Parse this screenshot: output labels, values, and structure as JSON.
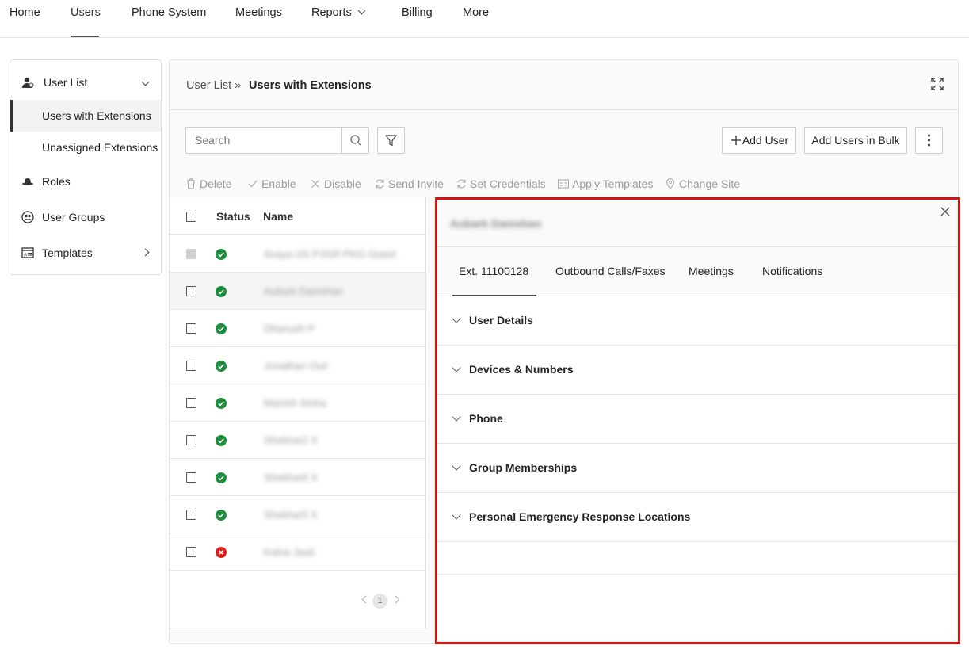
{
  "topnav": {
    "items": [
      {
        "label": "Home"
      },
      {
        "label": "Users"
      },
      {
        "label": "Phone System"
      },
      {
        "label": "Meetings"
      },
      {
        "label": "Reports"
      },
      {
        "label": "Billing"
      },
      {
        "label": "More"
      }
    ],
    "active": "Users"
  },
  "sidebar": {
    "user_list": "User List",
    "users_with_extensions": "Users with Extensions",
    "unassigned_extensions": "Unassigned Extensions",
    "roles": "Roles",
    "user_groups": "User Groups",
    "templates": "Templates"
  },
  "breadcrumb": {
    "parent": "User List",
    "separator": "»",
    "current": "Users with Extensions"
  },
  "search": {
    "placeholder": "Search",
    "value": ""
  },
  "buttons": {
    "add_user": "Add User",
    "add_users_bulk": "Add Users in Bulk"
  },
  "toolbar": {
    "delete": "Delete",
    "enable": "Enable",
    "disable": "Disable",
    "send_invite": "Send Invite",
    "set_credentials": "Set Credentials",
    "apply_templates": "Apply Templates",
    "change_site": "Change Site"
  },
  "table": {
    "columns": {
      "status": "Status",
      "name": "Name"
    },
    "rows": [
      {
        "status": "disabled-row",
        "name": "Avaya US PJGR-PKG-Guest"
      },
      {
        "status": "active",
        "name": "Aubark Danishan"
      },
      {
        "status": "active",
        "name": "Dhanush P"
      },
      {
        "status": "active",
        "name": "Jonathan Ouil"
      },
      {
        "status": "active",
        "name": "Manish Sinha"
      },
      {
        "status": "active",
        "name": "Shekhar2 X"
      },
      {
        "status": "active",
        "name": "Shekhar6 X"
      },
      {
        "status": "active",
        "name": "Shekhar5 X"
      },
      {
        "status": "error",
        "name": "Kalna Jasit"
      }
    ],
    "page": "1"
  },
  "detail": {
    "user_name": "Aubark Danishan",
    "tabs": [
      {
        "label": "Ext. 11100128"
      },
      {
        "label": "Outbound Calls/Faxes"
      },
      {
        "label": "Meetings"
      },
      {
        "label": "Notifications"
      }
    ],
    "sections": [
      {
        "label": "User Details"
      },
      {
        "label": "Devices & Numbers"
      },
      {
        "label": "Phone"
      },
      {
        "label": "Group Memberships"
      },
      {
        "label": "Personal Emergency Response Locations"
      }
    ]
  },
  "colors": {
    "status_ok": "#1e8e3e",
    "status_error": "#e02020",
    "highlight_border": "#e01010"
  }
}
